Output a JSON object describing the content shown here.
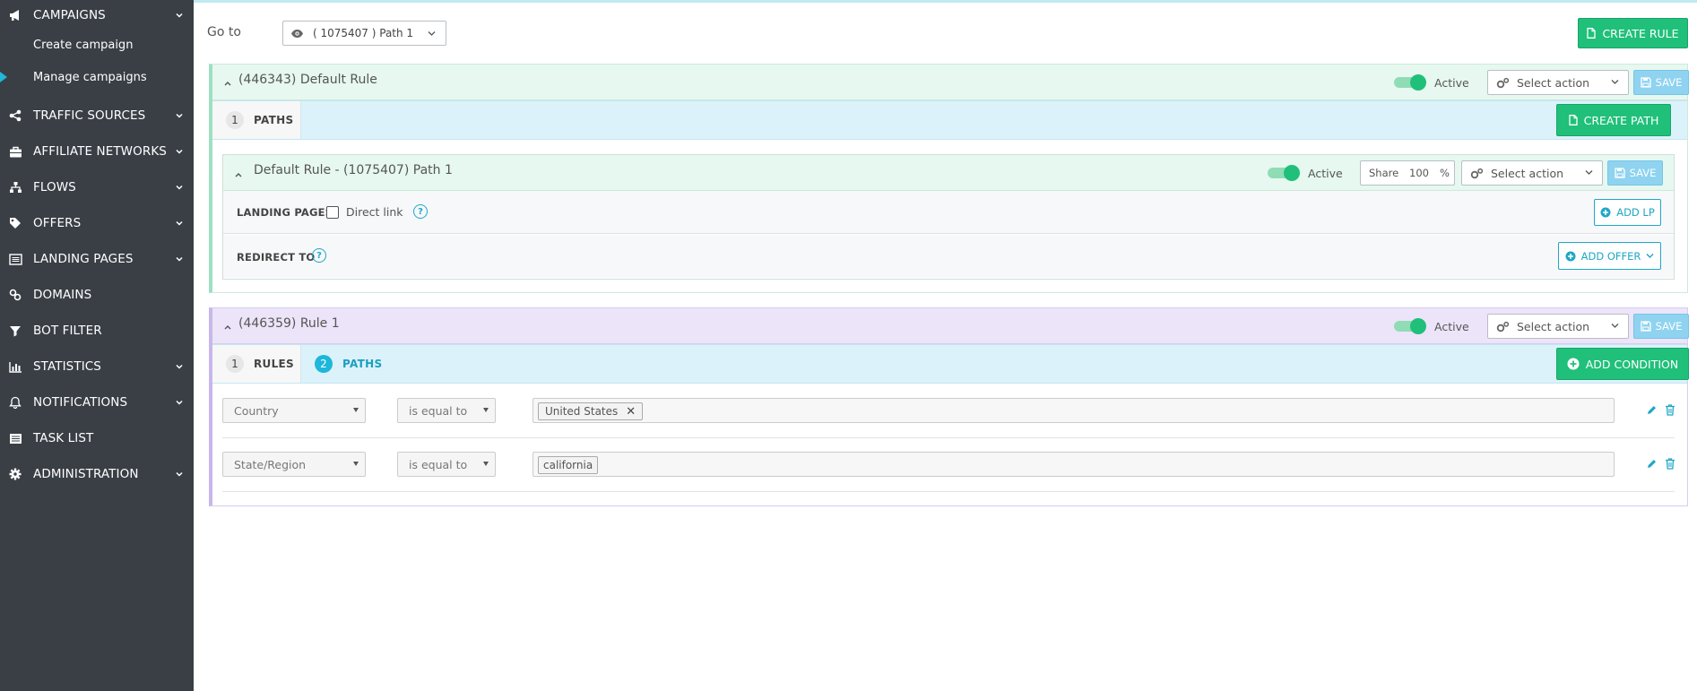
{
  "sidebar": {
    "items": [
      {
        "label": "CAMPAIGNS",
        "icon": "megaphone-icon",
        "expandable": true
      },
      {
        "label": "TRAFFIC SOURCES",
        "icon": "share-icon",
        "expandable": true
      },
      {
        "label": "AFFILIATE NETWORKS",
        "icon": "briefcase-icon",
        "expandable": true
      },
      {
        "label": "FLOWS",
        "icon": "sitemap-icon",
        "expandable": true
      },
      {
        "label": "OFFERS",
        "icon": "tags-icon",
        "expandable": true
      },
      {
        "label": "LANDING PAGES",
        "icon": "list-alt-icon",
        "expandable": true
      },
      {
        "label": "DOMAINS",
        "icon": "link-icon",
        "expandable": false
      },
      {
        "label": "BOT FILTER",
        "icon": "filter-icon",
        "expandable": false
      },
      {
        "label": "STATISTICS",
        "icon": "bar-chart-icon",
        "expandable": true
      },
      {
        "label": "NOTIFICATIONS",
        "icon": "bell-icon",
        "expandable": true
      },
      {
        "label": "TASK LIST",
        "icon": "list-icon",
        "expandable": false
      },
      {
        "label": "ADMINISTRATION",
        "icon": "gear-icon",
        "expandable": true
      }
    ],
    "sub_items": [
      {
        "label": "Create campaign",
        "active": false
      },
      {
        "label": "Manage campaigns",
        "active": true
      }
    ]
  },
  "header": {
    "goto_label": "Go to",
    "goto_value": "( 1075407 ) Path 1",
    "create_rule_label": "CREATE RULE"
  },
  "default_rule": {
    "title": "(446343) Default Rule",
    "active_label": "Active",
    "action_placeholder": "Select action",
    "save_label": "SAVE",
    "tab_paths_num": "1",
    "tab_paths_label": "PATHS",
    "create_path_label": "CREATE PATH",
    "path": {
      "title": "Default Rule - (1075407) Path 1",
      "active_label": "Active",
      "share_label": "Share",
      "share_value": "100",
      "share_unit": "%",
      "action_placeholder": "Select action",
      "save_label": "SAVE",
      "landing_pages_label": "LANDING PAGES",
      "direct_link_label": "Direct link",
      "help_glyph": "?",
      "add_lp_label": "ADD LP",
      "redirect_to_label": "REDIRECT TO",
      "add_offer_label": "ADD OFFER"
    }
  },
  "rule1": {
    "title": "(446359) Rule 1",
    "active_label": "Active",
    "action_placeholder": "Select action",
    "save_label": "SAVE",
    "tab_rules_num": "1",
    "tab_rules_label": "RULES",
    "tab_paths_num": "2",
    "tab_paths_label": "PATHS",
    "add_condition_label": "ADD CONDITION",
    "conditions": [
      {
        "field": "Country",
        "operator": "is equal to",
        "value": "United States",
        "removable": true
      },
      {
        "field": "State/Region",
        "operator": "is equal to",
        "value": "california",
        "removable": false
      }
    ],
    "remove_glyph": "✕"
  },
  "colors": {
    "sidebar_bg": "#3a3f46",
    "green": "#20c07a",
    "save_blue": "#8fd3f0",
    "accent_teal": "#1fa7c6",
    "default_rule_bg": "#e6f8f0",
    "rule1_bg": "#ece4f9",
    "tabbar_bg": "#dcf2fa"
  }
}
